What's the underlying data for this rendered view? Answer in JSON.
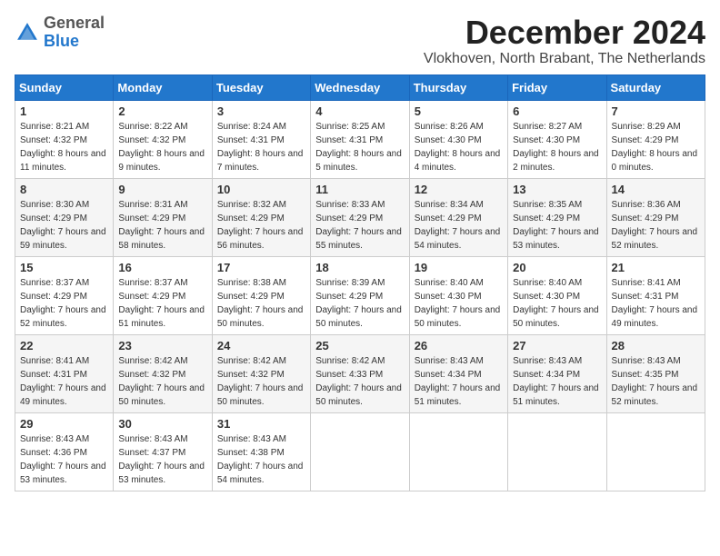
{
  "header": {
    "logo_general": "General",
    "logo_blue": "Blue",
    "month_title": "December 2024",
    "location": "Vlokhoven, North Brabant, The Netherlands"
  },
  "weekdays": [
    "Sunday",
    "Monday",
    "Tuesday",
    "Wednesday",
    "Thursday",
    "Friday",
    "Saturday"
  ],
  "weeks": [
    [
      {
        "day": "1",
        "sunrise": "8:21 AM",
        "sunset": "4:32 PM",
        "daylight": "8 hours and 11 minutes."
      },
      {
        "day": "2",
        "sunrise": "8:22 AM",
        "sunset": "4:32 PM",
        "daylight": "8 hours and 9 minutes."
      },
      {
        "day": "3",
        "sunrise": "8:24 AM",
        "sunset": "4:31 PM",
        "daylight": "8 hours and 7 minutes."
      },
      {
        "day": "4",
        "sunrise": "8:25 AM",
        "sunset": "4:31 PM",
        "daylight": "8 hours and 5 minutes."
      },
      {
        "day": "5",
        "sunrise": "8:26 AM",
        "sunset": "4:30 PM",
        "daylight": "8 hours and 4 minutes."
      },
      {
        "day": "6",
        "sunrise": "8:27 AM",
        "sunset": "4:30 PM",
        "daylight": "8 hours and 2 minutes."
      },
      {
        "day": "7",
        "sunrise": "8:29 AM",
        "sunset": "4:29 PM",
        "daylight": "8 hours and 0 minutes."
      }
    ],
    [
      {
        "day": "8",
        "sunrise": "8:30 AM",
        "sunset": "4:29 PM",
        "daylight": "7 hours and 59 minutes."
      },
      {
        "day": "9",
        "sunrise": "8:31 AM",
        "sunset": "4:29 PM",
        "daylight": "7 hours and 58 minutes."
      },
      {
        "day": "10",
        "sunrise": "8:32 AM",
        "sunset": "4:29 PM",
        "daylight": "7 hours and 56 minutes."
      },
      {
        "day": "11",
        "sunrise": "8:33 AM",
        "sunset": "4:29 PM",
        "daylight": "7 hours and 55 minutes."
      },
      {
        "day": "12",
        "sunrise": "8:34 AM",
        "sunset": "4:29 PM",
        "daylight": "7 hours and 54 minutes."
      },
      {
        "day": "13",
        "sunrise": "8:35 AM",
        "sunset": "4:29 PM",
        "daylight": "7 hours and 53 minutes."
      },
      {
        "day": "14",
        "sunrise": "8:36 AM",
        "sunset": "4:29 PM",
        "daylight": "7 hours and 52 minutes."
      }
    ],
    [
      {
        "day": "15",
        "sunrise": "8:37 AM",
        "sunset": "4:29 PM",
        "daylight": "7 hours and 52 minutes."
      },
      {
        "day": "16",
        "sunrise": "8:37 AM",
        "sunset": "4:29 PM",
        "daylight": "7 hours and 51 minutes."
      },
      {
        "day": "17",
        "sunrise": "8:38 AM",
        "sunset": "4:29 PM",
        "daylight": "7 hours and 50 minutes."
      },
      {
        "day": "18",
        "sunrise": "8:39 AM",
        "sunset": "4:29 PM",
        "daylight": "7 hours and 50 minutes."
      },
      {
        "day": "19",
        "sunrise": "8:40 AM",
        "sunset": "4:30 PM",
        "daylight": "7 hours and 50 minutes."
      },
      {
        "day": "20",
        "sunrise": "8:40 AM",
        "sunset": "4:30 PM",
        "daylight": "7 hours and 50 minutes."
      },
      {
        "day": "21",
        "sunrise": "8:41 AM",
        "sunset": "4:31 PM",
        "daylight": "7 hours and 49 minutes."
      }
    ],
    [
      {
        "day": "22",
        "sunrise": "8:41 AM",
        "sunset": "4:31 PM",
        "daylight": "7 hours and 49 minutes."
      },
      {
        "day": "23",
        "sunrise": "8:42 AM",
        "sunset": "4:32 PM",
        "daylight": "7 hours and 50 minutes."
      },
      {
        "day": "24",
        "sunrise": "8:42 AM",
        "sunset": "4:32 PM",
        "daylight": "7 hours and 50 minutes."
      },
      {
        "day": "25",
        "sunrise": "8:42 AM",
        "sunset": "4:33 PM",
        "daylight": "7 hours and 50 minutes."
      },
      {
        "day": "26",
        "sunrise": "8:43 AM",
        "sunset": "4:34 PM",
        "daylight": "7 hours and 51 minutes."
      },
      {
        "day": "27",
        "sunrise": "8:43 AM",
        "sunset": "4:34 PM",
        "daylight": "7 hours and 51 minutes."
      },
      {
        "day": "28",
        "sunrise": "8:43 AM",
        "sunset": "4:35 PM",
        "daylight": "7 hours and 52 minutes."
      }
    ],
    [
      {
        "day": "29",
        "sunrise": "8:43 AM",
        "sunset": "4:36 PM",
        "daylight": "7 hours and 53 minutes."
      },
      {
        "day": "30",
        "sunrise": "8:43 AM",
        "sunset": "4:37 PM",
        "daylight": "7 hours and 53 minutes."
      },
      {
        "day": "31",
        "sunrise": "8:43 AM",
        "sunset": "4:38 PM",
        "daylight": "7 hours and 54 minutes."
      },
      null,
      null,
      null,
      null
    ]
  ]
}
